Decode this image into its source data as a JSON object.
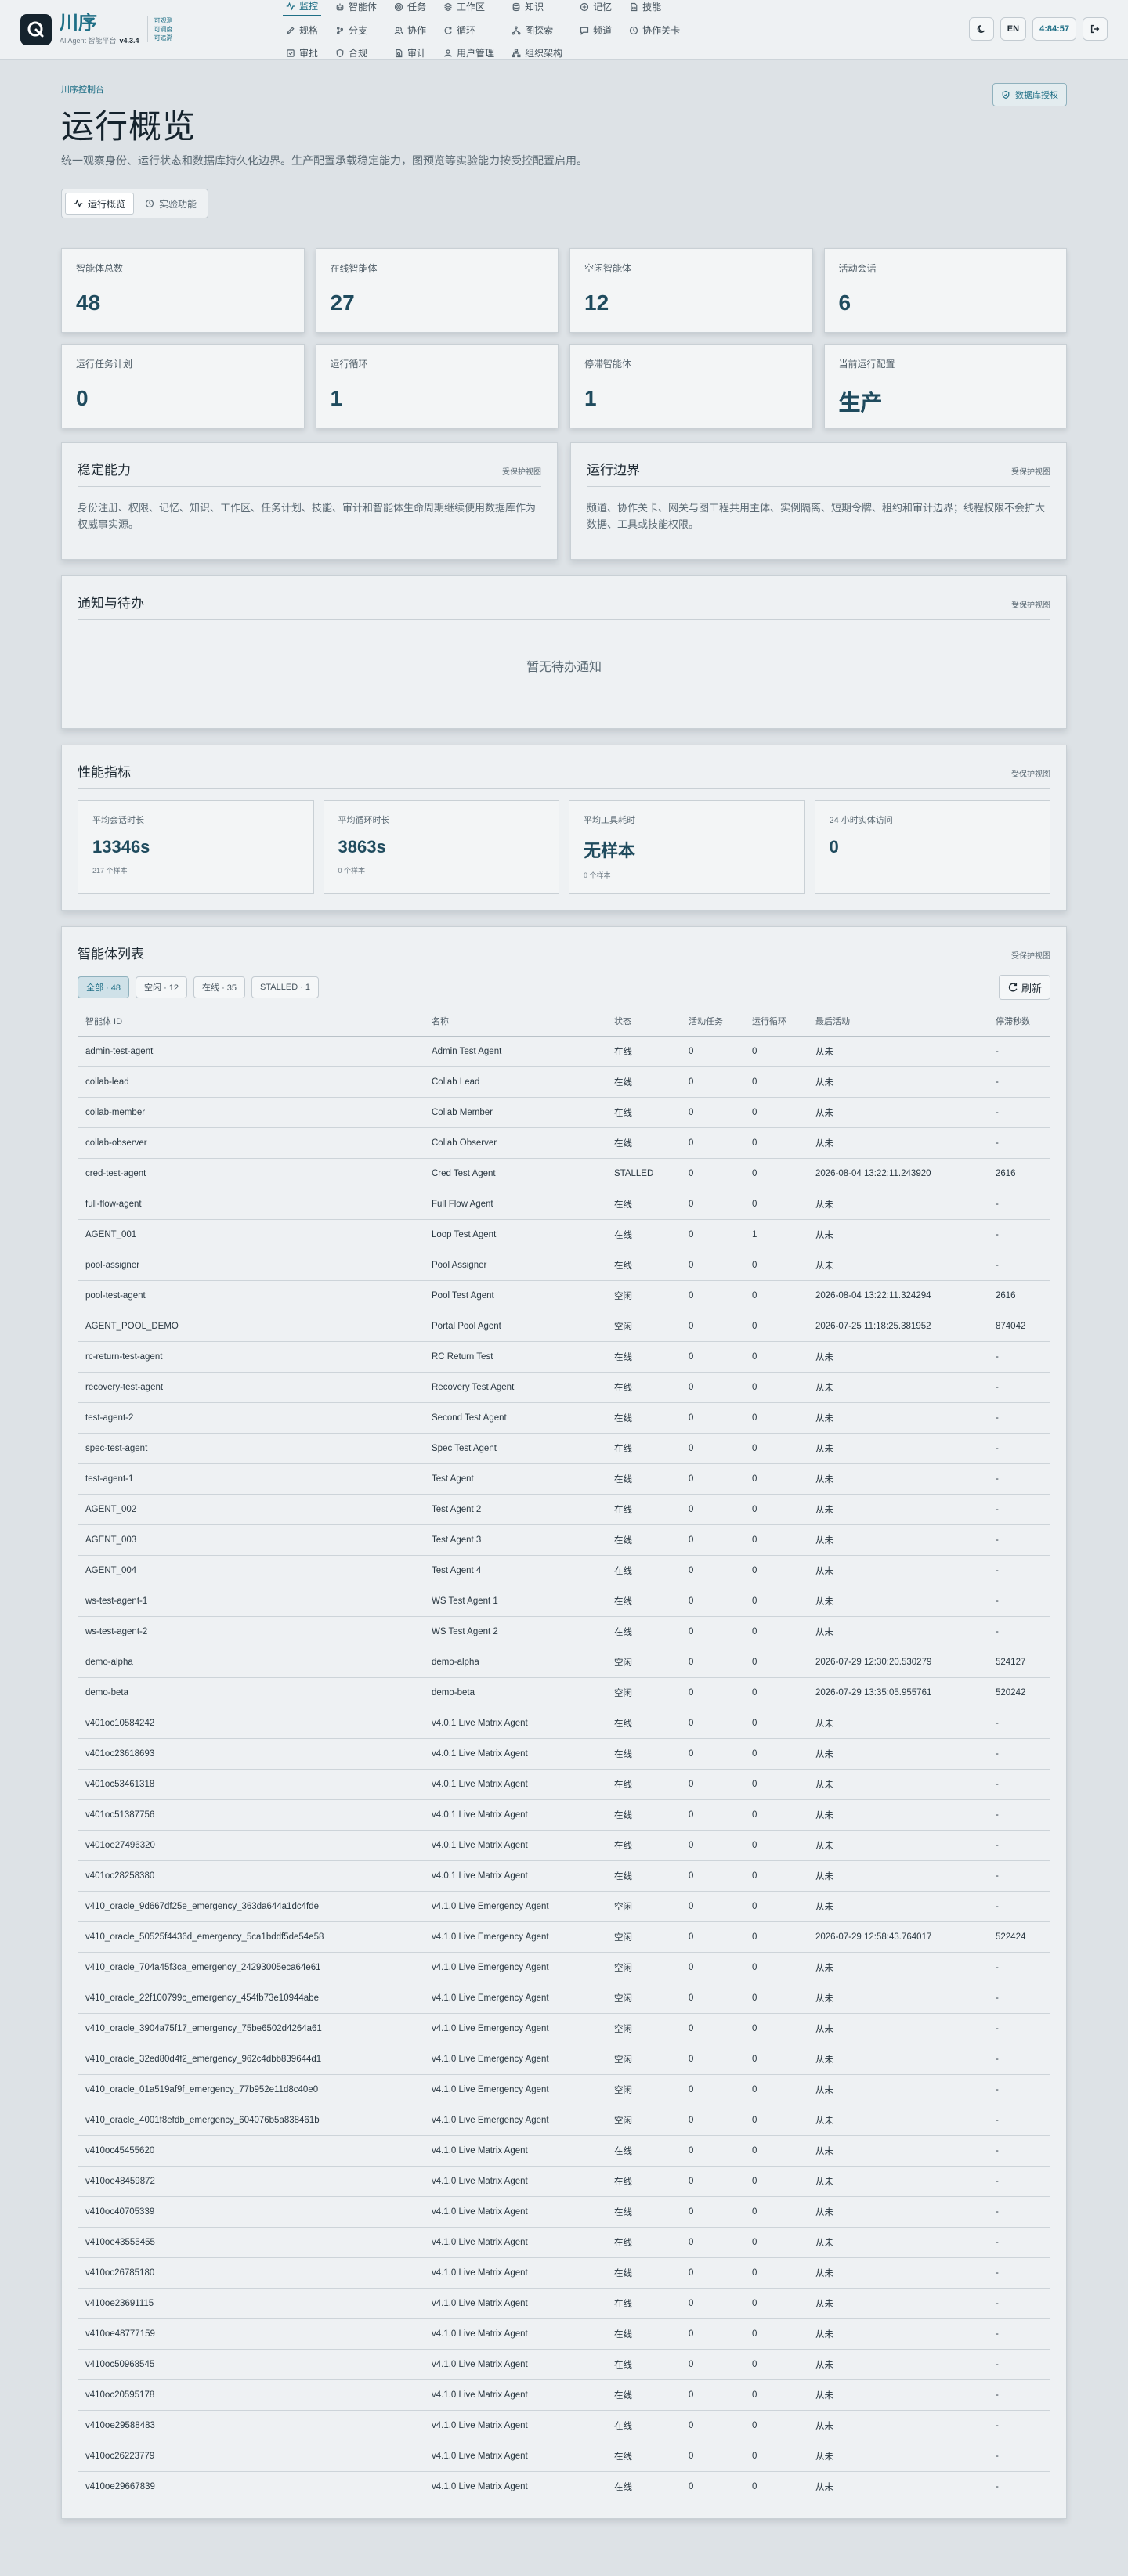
{
  "brand": {
    "name": "川序",
    "subtitle": "AI Agent 智能平台",
    "version": "v4.3.4",
    "tags": [
      "可观测",
      "可调度",
      "可追溯"
    ]
  },
  "nav": {
    "items": [
      {
        "label": "监控",
        "icon": "activity-icon",
        "active": true
      },
      {
        "label": "智能体",
        "icon": "bot-icon"
      },
      {
        "label": "任务",
        "icon": "target-icon"
      },
      {
        "label": "工作区",
        "icon": "layers-icon"
      },
      {
        "label": "知识",
        "icon": "database-icon"
      },
      {
        "label": "记忆",
        "icon": "memory-icon"
      },
      {
        "label": "技能",
        "icon": "file-code-icon"
      },
      {
        "label": "规格",
        "icon": "edit-icon"
      },
      {
        "label": "分支",
        "icon": "git-branch-icon"
      },
      {
        "label": "协作",
        "icon": "users-icon"
      },
      {
        "label": "循环",
        "icon": "refresh-icon"
      },
      {
        "label": "图探索",
        "icon": "network-icon"
      },
      {
        "label": "频道",
        "icon": "message-icon"
      },
      {
        "label": "协作关卡",
        "icon": "clock-icon"
      },
      {
        "label": "审批",
        "icon": "check-square-icon"
      },
      {
        "label": "合规",
        "icon": "shield-icon"
      },
      {
        "label": "审计",
        "icon": "file-search-icon"
      },
      {
        "label": "用户管理",
        "icon": "user-icon"
      },
      {
        "label": "组织架构",
        "icon": "org-icon"
      }
    ]
  },
  "top_actions": {
    "theme_icon": "moon-icon",
    "lang": "EN",
    "clock": "4:84:57",
    "logout_icon": "logout-icon"
  },
  "hero": {
    "eyebrow": "川序控制台",
    "title": "运行概览",
    "description": "统一观察身份、运行状态和数据库持久化边界。生产配置承载稳定能力，图预览等实验能力按受控配置启用。",
    "db_auth_label": "数据库授权",
    "tabs": [
      {
        "label": "运行概览",
        "icon": "activity-icon",
        "active": true
      },
      {
        "label": "实验功能",
        "icon": "clock-icon"
      }
    ]
  },
  "stats": [
    {
      "label": "智能体总数",
      "value": "48"
    },
    {
      "label": "在线智能体",
      "value": "27"
    },
    {
      "label": "空闲智能体",
      "value": "12"
    },
    {
      "label": "活动会话",
      "value": "6"
    },
    {
      "label": "运行任务计划",
      "value": "0"
    },
    {
      "label": "运行循环",
      "value": "1"
    },
    {
      "label": "停滞智能体",
      "value": "1"
    },
    {
      "label": "当前运行配置",
      "value": "生产"
    }
  ],
  "capabilities": [
    {
      "title": "稳定能力",
      "tag": "受保护视图",
      "description": "身份注册、权限、记忆、知识、工作区、任务计划、技能、审计和智能体生命周期继续使用数据库作为权威事实源。"
    },
    {
      "title": "运行边界",
      "tag": "受保护视图",
      "description": "频道、协作关卡、网关与图工程共用主体、实例隔离、短期令牌、租约和审计边界；线程权限不会扩大数据、工具或技能权限。"
    }
  ],
  "notifications": {
    "title": "通知与待办",
    "tag": "受保护视图",
    "empty": "暂无待办通知"
  },
  "performance": {
    "title": "性能指标",
    "tag": "受保护视图",
    "metrics": [
      {
        "label": "平均会话时长",
        "value": "13346s",
        "sub": "217 个样本"
      },
      {
        "label": "平均循环时长",
        "value": "3863s",
        "sub": "0 个样本"
      },
      {
        "label": "平均工具耗时",
        "value": "无样本",
        "sub": "0 个样本"
      },
      {
        "label": "24 小时实体访问",
        "value": "0",
        "sub": ""
      }
    ]
  },
  "agents": {
    "title": "智能体列表",
    "tag": "受保护视图",
    "filters": [
      {
        "label": "全部 · 48",
        "active": true
      },
      {
        "label": "空闲 · 12"
      },
      {
        "label": "在线 · 35"
      },
      {
        "label": "STALLED · 1"
      }
    ],
    "refresh_label": "刷新",
    "columns": [
      "智能体 ID",
      "名称",
      "状态",
      "活动任务",
      "运行循环",
      "最后活动",
      "停滞秒数"
    ],
    "rows": [
      [
        "admin-test-agent",
        "Admin Test Agent",
        "在线",
        "0",
        "0",
        "从未",
        "-"
      ],
      [
        "collab-lead",
        "Collab Lead",
        "在线",
        "0",
        "0",
        "从未",
        "-"
      ],
      [
        "collab-member",
        "Collab Member",
        "在线",
        "0",
        "0",
        "从未",
        "-"
      ],
      [
        "collab-observer",
        "Collab Observer",
        "在线",
        "0",
        "0",
        "从未",
        "-"
      ],
      [
        "cred-test-agent",
        "Cred Test Agent",
        "STALLED",
        "0",
        "0",
        "2026-08-04 13:22:11.243920",
        "2616"
      ],
      [
        "full-flow-agent",
        "Full Flow Agent",
        "在线",
        "0",
        "0",
        "从未",
        "-"
      ],
      [
        "AGENT_001",
        "Loop Test Agent",
        "在线",
        "0",
        "1",
        "从未",
        "-"
      ],
      [
        "pool-assigner",
        "Pool Assigner",
        "在线",
        "0",
        "0",
        "从未",
        "-"
      ],
      [
        "pool-test-agent",
        "Pool Test Agent",
        "空闲",
        "0",
        "0",
        "2026-08-04 13:22:11.324294",
        "2616"
      ],
      [
        "AGENT_POOL_DEMO",
        "Portal Pool Agent",
        "空闲",
        "0",
        "0",
        "2026-07-25 11:18:25.381952",
        "874042"
      ],
      [
        "rc-return-test-agent",
        "RC Return Test",
        "在线",
        "0",
        "0",
        "从未",
        "-"
      ],
      [
        "recovery-test-agent",
        "Recovery Test Agent",
        "在线",
        "0",
        "0",
        "从未",
        "-"
      ],
      [
        "test-agent-2",
        "Second Test Agent",
        "在线",
        "0",
        "0",
        "从未",
        "-"
      ],
      [
        "spec-test-agent",
        "Spec Test Agent",
        "在线",
        "0",
        "0",
        "从未",
        "-"
      ],
      [
        "test-agent-1",
        "Test Agent",
        "在线",
        "0",
        "0",
        "从未",
        "-"
      ],
      [
        "AGENT_002",
        "Test Agent 2",
        "在线",
        "0",
        "0",
        "从未",
        "-"
      ],
      [
        "AGENT_003",
        "Test Agent 3",
        "在线",
        "0",
        "0",
        "从未",
        "-"
      ],
      [
        "AGENT_004",
        "Test Agent 4",
        "在线",
        "0",
        "0",
        "从未",
        "-"
      ],
      [
        "ws-test-agent-1",
        "WS Test Agent 1",
        "在线",
        "0",
        "0",
        "从未",
        "-"
      ],
      [
        "ws-test-agent-2",
        "WS Test Agent 2",
        "在线",
        "0",
        "0",
        "从未",
        "-"
      ],
      [
        "demo-alpha",
        "demo-alpha",
        "空闲",
        "0",
        "0",
        "2026-07-29 12:30:20.530279",
        "524127"
      ],
      [
        "demo-beta",
        "demo-beta",
        "空闲",
        "0",
        "0",
        "2026-07-29 13:35:05.955761",
        "520242"
      ],
      [
        "v401oc10584242",
        "v4.0.1 Live Matrix Agent",
        "在线",
        "0",
        "0",
        "从未",
        "-"
      ],
      [
        "v401oc23618693",
        "v4.0.1 Live Matrix Agent",
        "在线",
        "0",
        "0",
        "从未",
        "-"
      ],
      [
        "v401oc53461318",
        "v4.0.1 Live Matrix Agent",
        "在线",
        "0",
        "0",
        "从未",
        "-"
      ],
      [
        "v401oc51387756",
        "v4.0.1 Live Matrix Agent",
        "在线",
        "0",
        "0",
        "从未",
        "-"
      ],
      [
        "v401oe27496320",
        "v4.0.1 Live Matrix Agent",
        "在线",
        "0",
        "0",
        "从未",
        "-"
      ],
      [
        "v401oc28258380",
        "v4.0.1 Live Matrix Agent",
        "在线",
        "0",
        "0",
        "从未",
        "-"
      ],
      [
        "v410_oracle_9d667df25e_emergency_363da644a1dc4fde",
        "v4.1.0 Live Emergency Agent",
        "空闲",
        "0",
        "0",
        "从未",
        "-"
      ],
      [
        "v410_oracle_50525f4436d_emergency_5ca1bddf5de54e58",
        "v4.1.0 Live Emergency Agent",
        "空闲",
        "0",
        "0",
        "2026-07-29 12:58:43.764017",
        "522424"
      ],
      [
        "v410_oracle_704a45f3ca_emergency_24293005eca64e61",
        "v4.1.0 Live Emergency Agent",
        "空闲",
        "0",
        "0",
        "从未",
        "-"
      ],
      [
        "v410_oracle_22f100799c_emergency_454fb73e10944abe",
        "v4.1.0 Live Emergency Agent",
        "空闲",
        "0",
        "0",
        "从未",
        "-"
      ],
      [
        "v410_oracle_3904a75f17_emergency_75be6502d4264a61",
        "v4.1.0 Live Emergency Agent",
        "空闲",
        "0",
        "0",
        "从未",
        "-"
      ],
      [
        "v410_oracle_32ed80d4f2_emergency_962c4dbb839644d1",
        "v4.1.0 Live Emergency Agent",
        "空闲",
        "0",
        "0",
        "从未",
        "-"
      ],
      [
        "v410_oracle_01a519af9f_emergency_77b952e11d8c40e0",
        "v4.1.0 Live Emergency Agent",
        "空闲",
        "0",
        "0",
        "从未",
        "-"
      ],
      [
        "v410_oracle_4001f8efdb_emergency_604076b5a838461b",
        "v4.1.0 Live Emergency Agent",
        "空闲",
        "0",
        "0",
        "从未",
        "-"
      ],
      [
        "v410oc45455620",
        "v4.1.0 Live Matrix Agent",
        "在线",
        "0",
        "0",
        "从未",
        "-"
      ],
      [
        "v410oe48459872",
        "v4.1.0 Live Matrix Agent",
        "在线",
        "0",
        "0",
        "从未",
        "-"
      ],
      [
        "v410oc40705339",
        "v4.1.0 Live Matrix Agent",
        "在线",
        "0",
        "0",
        "从未",
        "-"
      ],
      [
        "v410oe43555455",
        "v4.1.0 Live Matrix Agent",
        "在线",
        "0",
        "0",
        "从未",
        "-"
      ],
      [
        "v410oc26785180",
        "v4.1.0 Live Matrix Agent",
        "在线",
        "0",
        "0",
        "从未",
        "-"
      ],
      [
        "v410oe23691115",
        "v4.1.0 Live Matrix Agent",
        "在线",
        "0",
        "0",
        "从未",
        "-"
      ],
      [
        "v410oe48777159",
        "v4.1.0 Live Matrix Agent",
        "在线",
        "0",
        "0",
        "从未",
        "-"
      ],
      [
        "v410oc50968545",
        "v4.1.0 Live Matrix Agent",
        "在线",
        "0",
        "0",
        "从未",
        "-"
      ],
      [
        "v410oc20595178",
        "v4.1.0 Live Matrix Agent",
        "在线",
        "0",
        "0",
        "从未",
        "-"
      ],
      [
        "v410oe29588483",
        "v4.1.0 Live Matrix Agent",
        "在线",
        "0",
        "0",
        "从未",
        "-"
      ],
      [
        "v410oc26223779",
        "v4.1.0 Live Matrix Agent",
        "在线",
        "0",
        "0",
        "从未",
        "-"
      ],
      [
        "v410oe29667839",
        "v4.1.0 Live Matrix Agent",
        "在线",
        "0",
        "0",
        "从未",
        "-"
      ]
    ]
  },
  "colors": {
    "accent": "#1f6f86",
    "background": "#dde2e6",
    "surface": "#eef1f3"
  }
}
